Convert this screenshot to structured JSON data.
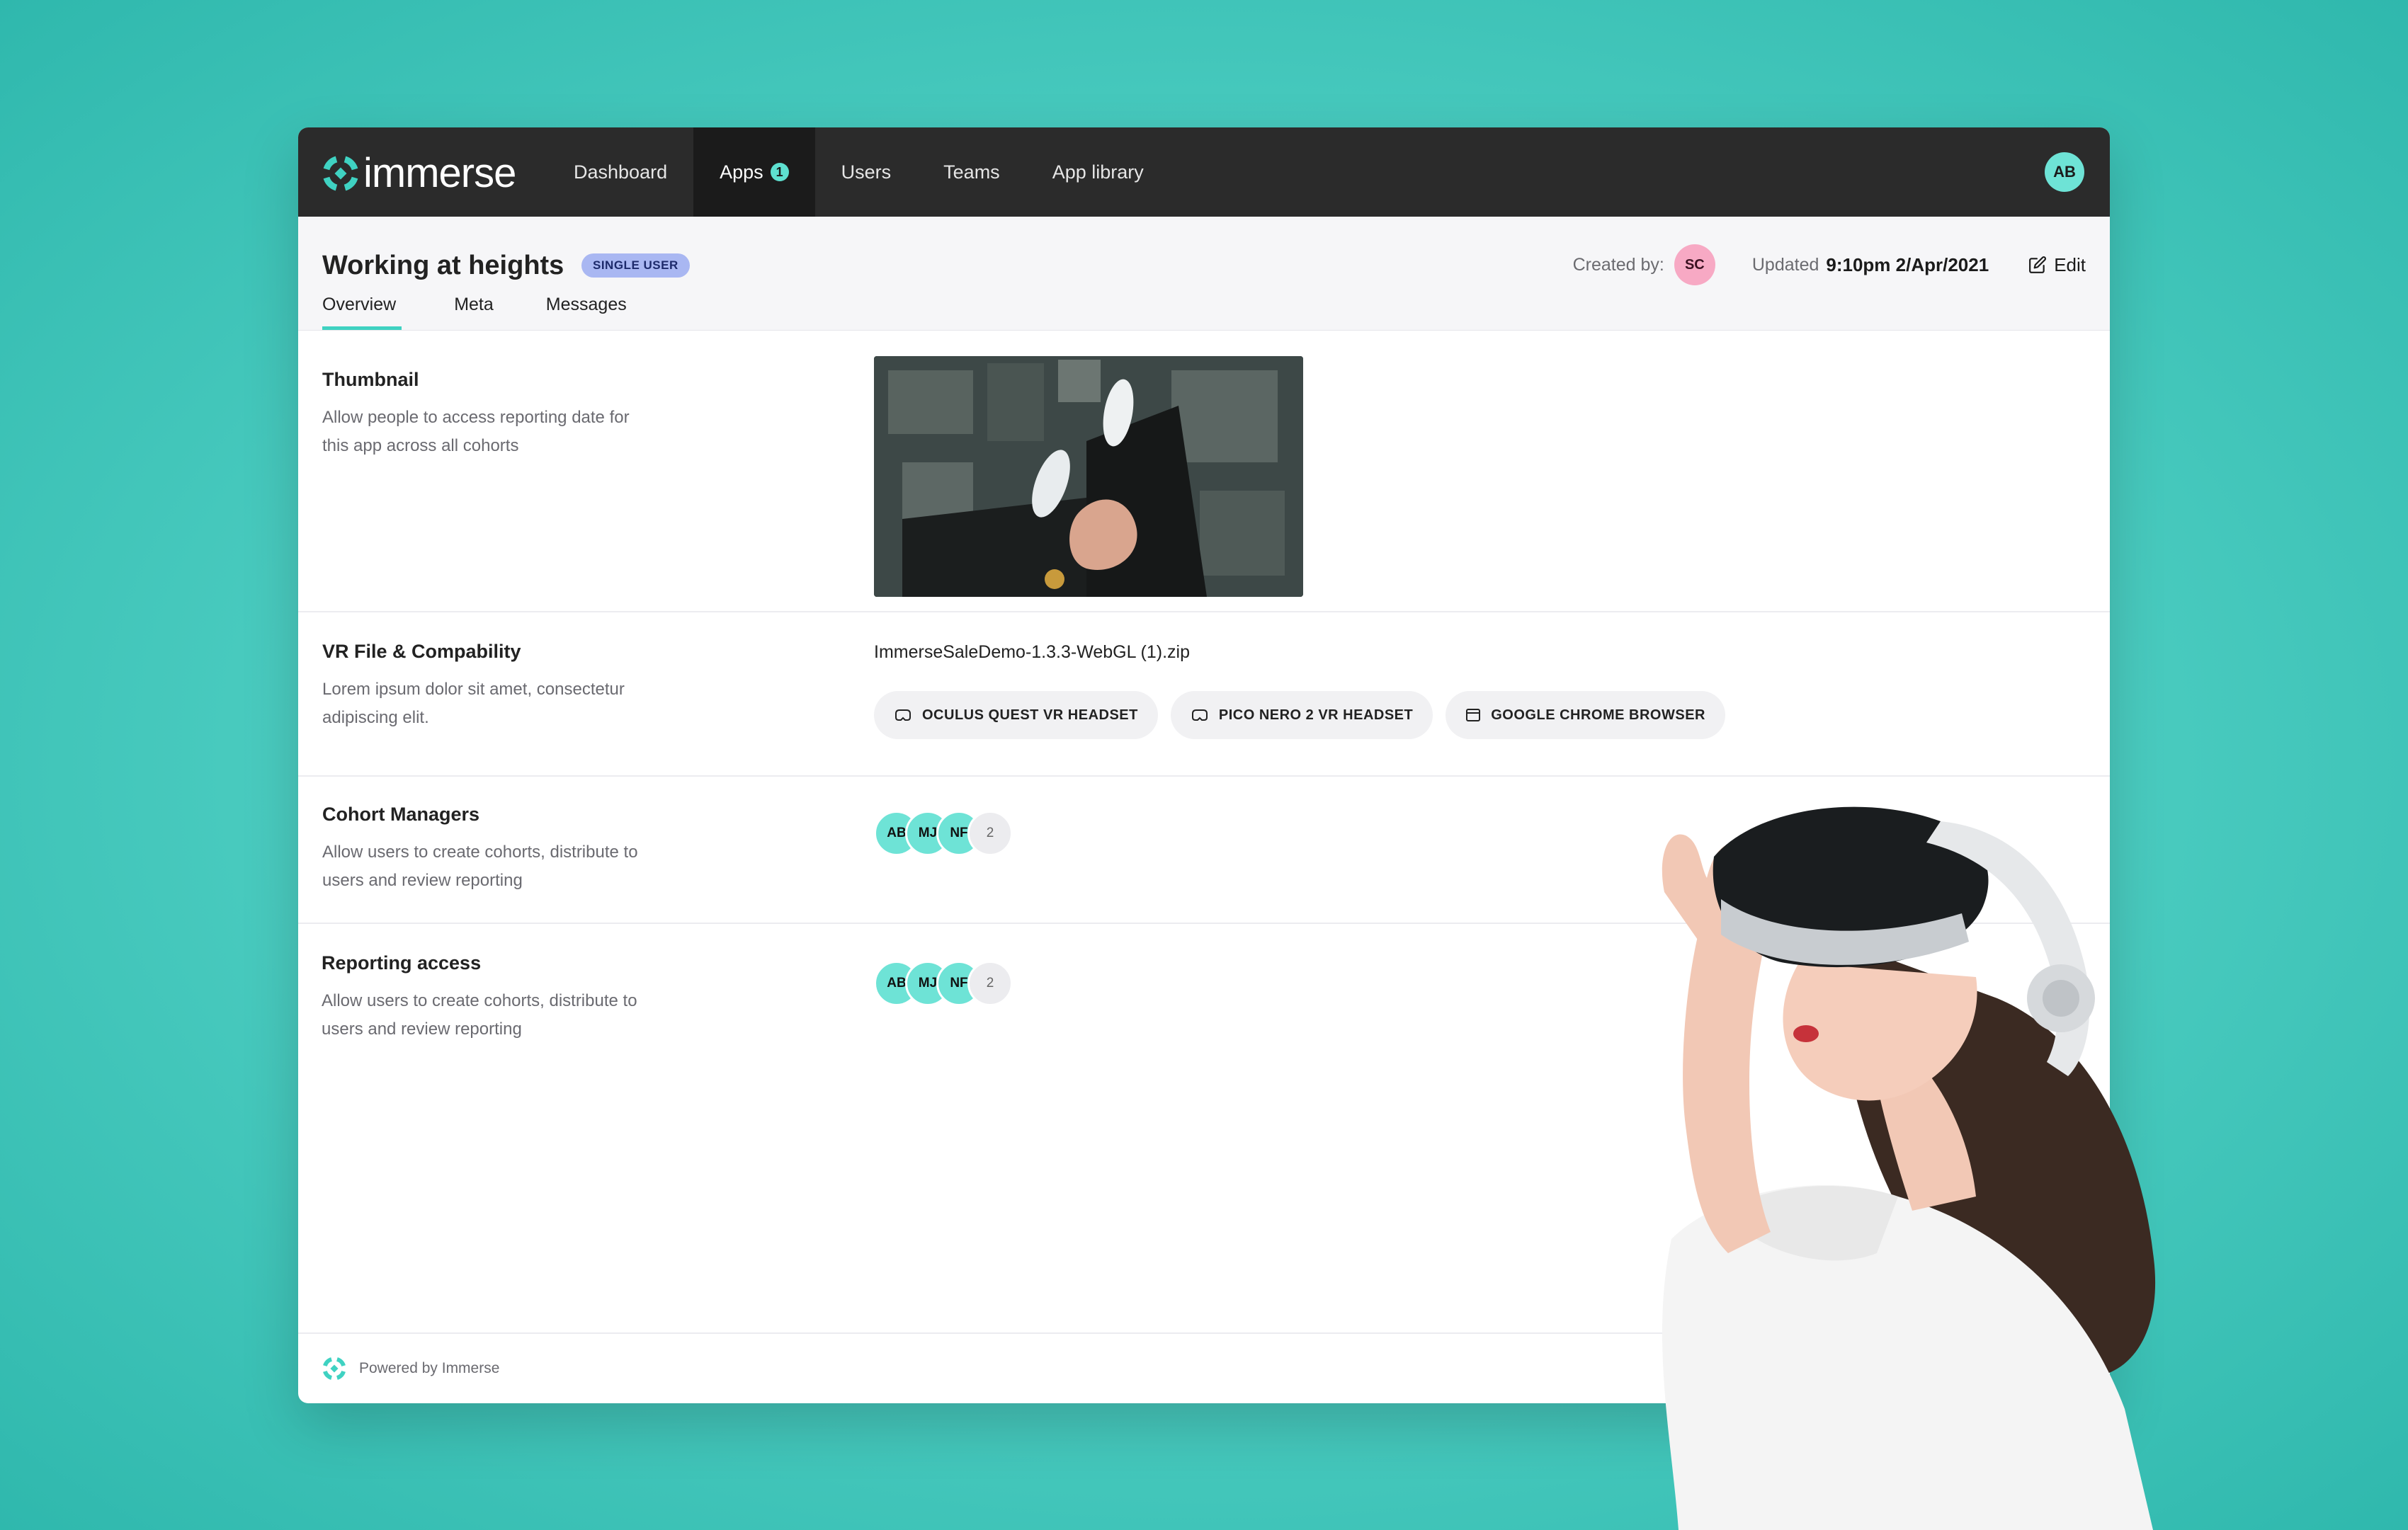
{
  "app": {
    "brand": "immerse",
    "accent_color": "#3fd2c2",
    "nav": {
      "items": [
        {
          "label": "Dashboard"
        },
        {
          "label": "Apps",
          "badge": "1"
        },
        {
          "label": "Users"
        },
        {
          "label": "Teams"
        },
        {
          "label": "App library"
        }
      ],
      "user_initials": "AB"
    }
  },
  "header": {
    "title": "Working at heights",
    "tag": "SINGLE USER",
    "created_by_label": "Created by:",
    "creator_initials": "SC",
    "updated_label": "Updated",
    "updated_value": "9:10pm 2/Apr/2021",
    "edit_label": "Edit",
    "tabs": [
      {
        "label": "Overview"
      },
      {
        "label": "Meta"
      },
      {
        "label": "Messages"
      }
    ]
  },
  "sections": {
    "thumbnail": {
      "title": "Thumbnail",
      "desc": "Allow people to access reporting date for this app across all cohorts"
    },
    "vr_file": {
      "title": "VR File & Compability",
      "desc": "Lorem ipsum dolor sit amet, consectetur adipiscing elit.",
      "filename": "ImmerseSaleDemo-1.3.3-WebGL (1).zip",
      "chips": [
        {
          "label": "OCULUS QUEST VR HEADSET",
          "icon": "vr-headset-icon"
        },
        {
          "label": "PICO NERO 2 VR HEADSET",
          "icon": "vr-headset-icon"
        },
        {
          "label": "GOOGLE CHROME BROWSER",
          "icon": "browser-icon"
        }
      ]
    },
    "cohort_managers": {
      "title": "Cohort Managers",
      "desc": "Allow users to create cohorts, distribute to users and review reporting",
      "avatars": [
        "AB",
        "MJ",
        "NF"
      ],
      "more": "2"
    },
    "reporting_access": {
      "title": "Reporting access",
      "desc": "Allow users to create cohorts, distribute to users and review reporting",
      "avatars": [
        "AB",
        "MJ",
        "NF"
      ],
      "more": "2"
    }
  },
  "footer": {
    "label": "Powered by Immerse"
  }
}
